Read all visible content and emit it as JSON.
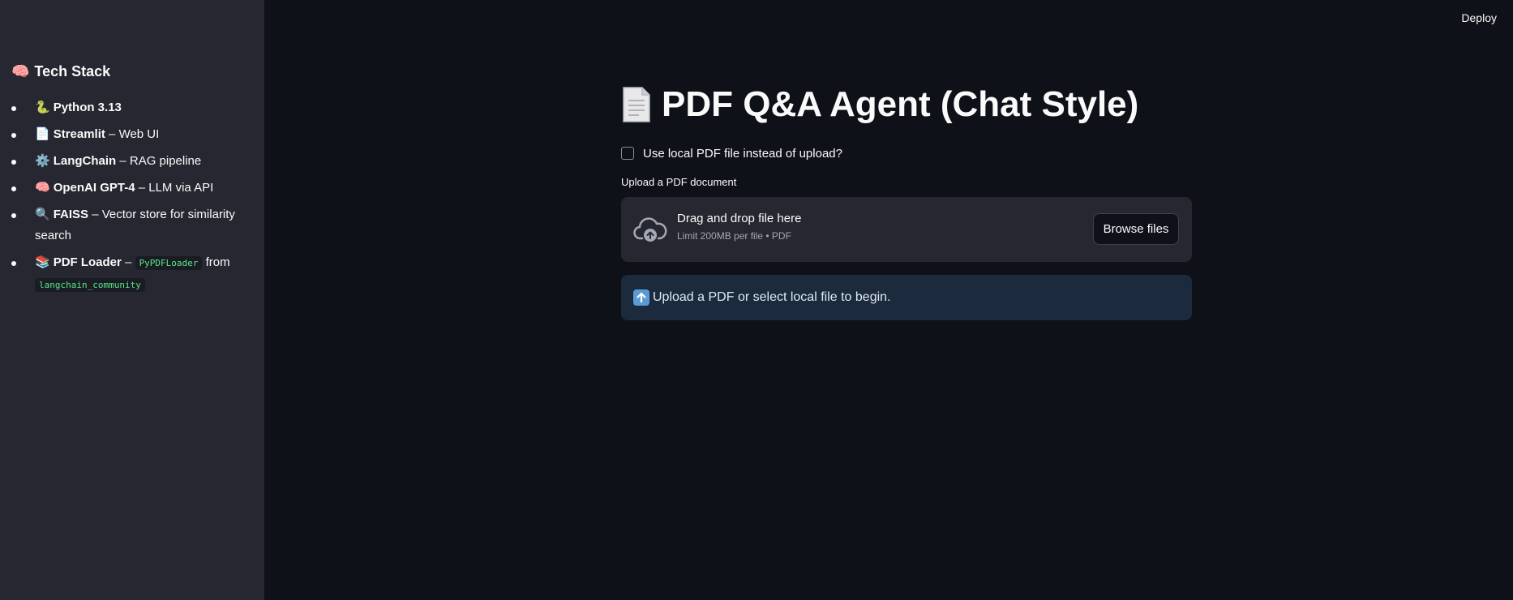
{
  "topbar": {
    "deploy_label": "Deploy"
  },
  "sidebar": {
    "title_emoji": "🧠",
    "title": "Tech Stack",
    "items": [
      {
        "emoji": "🐍",
        "name": "Python 3.13",
        "desc": ""
      },
      {
        "emoji": "📄",
        "name": "Streamlit",
        "desc": " – Web UI"
      },
      {
        "emoji": "⚙️",
        "name": "LangChain",
        "desc": " – RAG pipeline"
      },
      {
        "emoji": "🧠",
        "name": "OpenAI GPT-4",
        "desc": " – LLM via API"
      },
      {
        "emoji": "🔍",
        "name": "FAISS",
        "desc": " – Vector store for similarity search"
      },
      {
        "emoji": "📚",
        "name": "PDF Loader",
        "desc_prefix": " – ",
        "code1": "PyPDFLoader",
        "desc_mid": " from",
        "code2": "langchain_community"
      }
    ]
  },
  "main": {
    "title": "PDF Q&A Agent (Chat Style)",
    "checkbox_label": "Use local PDF file instead of upload?",
    "upload_label": "Upload a PDF document",
    "dropzone": {
      "main_text": "Drag and drop file here",
      "sub_text": "Limit 200MB per file • PDF",
      "browse_label": "Browse files"
    },
    "info_text": "Upload a PDF or select local file to begin."
  }
}
